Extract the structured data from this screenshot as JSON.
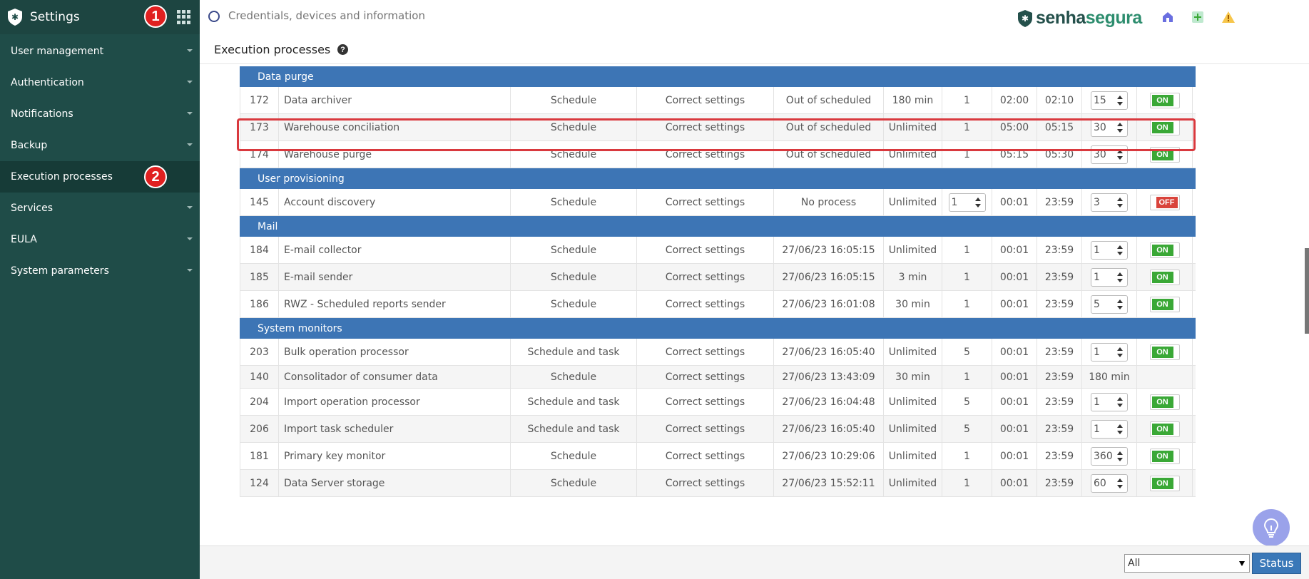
{
  "app": {
    "title": "Settings"
  },
  "sidebar": {
    "items": [
      {
        "label": "User management",
        "caret": true
      },
      {
        "label": "Authentication",
        "caret": true
      },
      {
        "label": "Notifications",
        "caret": true
      },
      {
        "label": "Backup",
        "caret": true
      },
      {
        "label": "Execution processes",
        "caret": false,
        "active": true
      },
      {
        "label": "Services",
        "caret": true
      },
      {
        "label": "EULA",
        "caret": true
      },
      {
        "label": "System parameters",
        "caret": true
      }
    ]
  },
  "annotations": {
    "badge1": "1",
    "badge2": "2"
  },
  "search": {
    "placeholder": "Credentials, devices and information"
  },
  "brand": {
    "part1": "senha",
    "part2": "segura",
    "icons": [
      "home-icon",
      "plus-icon",
      "warning-icon"
    ]
  },
  "page": {
    "title": "Execution processes",
    "help": "?"
  },
  "table": {
    "sections": [
      {
        "title": "Data purge",
        "rows": [
          {
            "id": "172",
            "name": "Data archiver",
            "type": "Schedule",
            "status": "Correct settings",
            "last_exec": "Out of scheduled",
            "duration": "180 min",
            "threads": "1",
            "start": "02:00",
            "end": "02:10",
            "interval": "15",
            "interval_stepper": true,
            "toggle": "ON"
          },
          {
            "id": "173",
            "name": "Warehouse conciliation",
            "type": "Schedule",
            "status": "Correct settings",
            "last_exec": "Out of scheduled",
            "duration": "Unlimited",
            "threads": "1",
            "start": "05:00",
            "end": "05:15",
            "interval": "30",
            "interval_stepper": true,
            "toggle": "ON"
          },
          {
            "id": "174",
            "name": "Warehouse purge",
            "type": "Schedule",
            "status": "Correct settings",
            "last_exec": "Out of scheduled",
            "duration": "Unlimited",
            "threads": "1",
            "start": "05:15",
            "end": "05:30",
            "interval": "30",
            "interval_stepper": true,
            "toggle": "ON"
          }
        ]
      },
      {
        "title": "User provisioning",
        "rows": [
          {
            "id": "145",
            "name": "Account discovery",
            "type": "Schedule",
            "status": "Correct settings",
            "last_exec": "No process",
            "duration": "Unlimited",
            "threads": "1",
            "threads_stepper": true,
            "start": "00:01",
            "end": "23:59",
            "interval": "3",
            "interval_stepper": true,
            "toggle": "OFF"
          }
        ]
      },
      {
        "title": "Mail",
        "rows": [
          {
            "id": "184",
            "name": "E-mail collector",
            "type": "Schedule",
            "status": "Correct settings",
            "last_exec": "27/06/23 16:05:15",
            "duration": "Unlimited",
            "threads": "1",
            "start": "00:01",
            "end": "23:59",
            "interval": "1",
            "interval_stepper": true,
            "toggle": "ON"
          },
          {
            "id": "185",
            "name": "E-mail sender",
            "type": "Schedule",
            "status": "Correct settings",
            "last_exec": "27/06/23 16:05:15",
            "duration": "3 min",
            "threads": "1",
            "start": "00:01",
            "end": "23:59",
            "interval": "1",
            "interval_stepper": true,
            "toggle": "ON"
          },
          {
            "id": "186",
            "name": "RWZ - Scheduled reports sender",
            "type": "Schedule",
            "status": "Correct settings",
            "last_exec": "27/06/23 16:01:08",
            "duration": "30 min",
            "threads": "1",
            "start": "00:01",
            "end": "23:59",
            "interval": "5",
            "interval_stepper": true,
            "toggle": "ON"
          }
        ]
      },
      {
        "title": "System monitors",
        "rows": [
          {
            "id": "203",
            "name": "Bulk operation processor",
            "type": "Schedule and task",
            "status": "Correct settings",
            "last_exec": "27/06/23 16:05:40",
            "duration": "Unlimited",
            "threads": "5",
            "start": "00:01",
            "end": "23:59",
            "interval": "1",
            "interval_stepper": true,
            "toggle": "ON"
          },
          {
            "id": "140",
            "name": "Consolitador of consumer data",
            "type": "Schedule",
            "status": "Correct settings",
            "last_exec": "27/06/23 13:43:09",
            "duration": "30 min",
            "threads": "1",
            "start": "00:01",
            "end": "23:59",
            "interval": "180 min",
            "interval_stepper": false,
            "toggle": ""
          },
          {
            "id": "204",
            "name": "Import operation processor",
            "type": "Schedule and task",
            "status": "Correct settings",
            "last_exec": "27/06/23 16:04:48",
            "duration": "Unlimited",
            "threads": "5",
            "start": "00:01",
            "end": "23:59",
            "interval": "1",
            "interval_stepper": true,
            "toggle": "ON"
          },
          {
            "id": "206",
            "name": "Import task scheduler",
            "type": "Schedule and task",
            "status": "Correct settings",
            "last_exec": "27/06/23 16:05:40",
            "duration": "Unlimited",
            "threads": "5",
            "start": "00:01",
            "end": "23:59",
            "interval": "1",
            "interval_stepper": true,
            "toggle": "ON"
          },
          {
            "id": "181",
            "name": "Primary key monitor",
            "type": "Schedule",
            "status": "Correct settings",
            "last_exec": "27/06/23 10:29:06",
            "duration": "Unlimited",
            "threads": "1",
            "start": "00:01",
            "end": "23:59",
            "interval": "360",
            "interval_stepper": true,
            "toggle": "ON"
          },
          {
            "id": "124",
            "name": "Data Server storage",
            "type": "Schedule",
            "status": "Correct settings",
            "last_exec": "27/06/23 15:52:11",
            "duration": "Unlimited",
            "threads": "1",
            "start": "00:01",
            "end": "23:59",
            "interval": "60",
            "interval_stepper": true,
            "toggle": "ON"
          }
        ]
      }
    ]
  },
  "footer": {
    "filter_value": "All",
    "status_button": "Status"
  },
  "colors": {
    "sidebar": "#1f4c48",
    "section_header": "#3d75b5",
    "toggle_on": "#3aa836",
    "toggle_off": "#d9433b",
    "highlight": "#d9393e"
  }
}
